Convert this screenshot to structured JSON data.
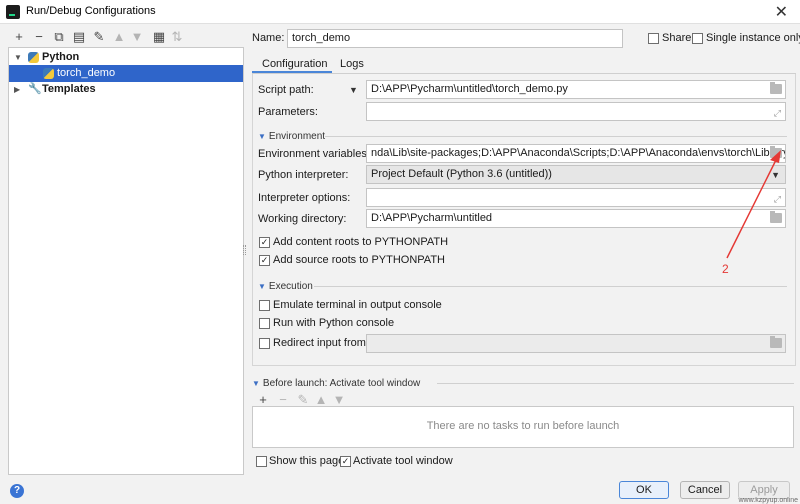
{
  "window": {
    "title": "Run/Debug Configurations"
  },
  "left_toolbar": {
    "icons": [
      "add-icon",
      "remove-icon",
      "copy-icon",
      "save-icon",
      "wrench-icon",
      "move-up-icon",
      "move-down-icon",
      "folder-icon",
      "sort-icon"
    ]
  },
  "tree": {
    "python": "Python",
    "torch_demo": "torch_demo",
    "templates": "Templates"
  },
  "header": {
    "name_label": "Name:",
    "name_value": "torch_demo",
    "share_label": "Share",
    "single_instance_label": "Single instance only"
  },
  "tabs": {
    "configuration": "Configuration",
    "logs": "Logs"
  },
  "config": {
    "script_path_label": "Script path:",
    "script_path_value": "D:\\APP\\Pycharm\\untitled\\torch_demo.py",
    "parameters_label": "Parameters:",
    "parameters_value": "",
    "environment_header": "Environment",
    "env_vars_label": "Environment variables:",
    "env_vars_value": "nda\\Lib\\site-packages;D:\\APP\\Anaconda\\Scripts;D:\\APP\\Anaconda\\envs\\torch\\Library\\bin;",
    "interpreter_label": "Python interpreter:",
    "interpreter_value": "Project Default (Python 3.6 (untitled))",
    "interp_options_label": "Interpreter options:",
    "interp_options_value": "",
    "working_dir_label": "Working directory:",
    "working_dir_value": "D:\\APP\\Pycharm\\untitled",
    "add_content_roots": "Add content roots to PYTHONPATH",
    "add_source_roots": "Add source roots to PYTHONPATH",
    "execution_header": "Execution",
    "emulate_terminal": "Emulate terminal in output console",
    "run_with_console": "Run with Python console",
    "redirect_input": "Redirect input from:"
  },
  "before_launch": {
    "header": "Before launch: Activate tool window",
    "empty_text": "There are no tasks to run before launch",
    "show_this_page": "Show this page",
    "activate_tool_window": "Activate tool window"
  },
  "buttons": {
    "ok": "OK",
    "cancel": "Cancel",
    "apply": "Apply"
  },
  "annotation": {
    "label": "2",
    "color": "#e53935"
  },
  "watermark": "www.kzpyup.online",
  "colors": {
    "selection": "#2f65ca",
    "accent": "#4a86d8"
  }
}
